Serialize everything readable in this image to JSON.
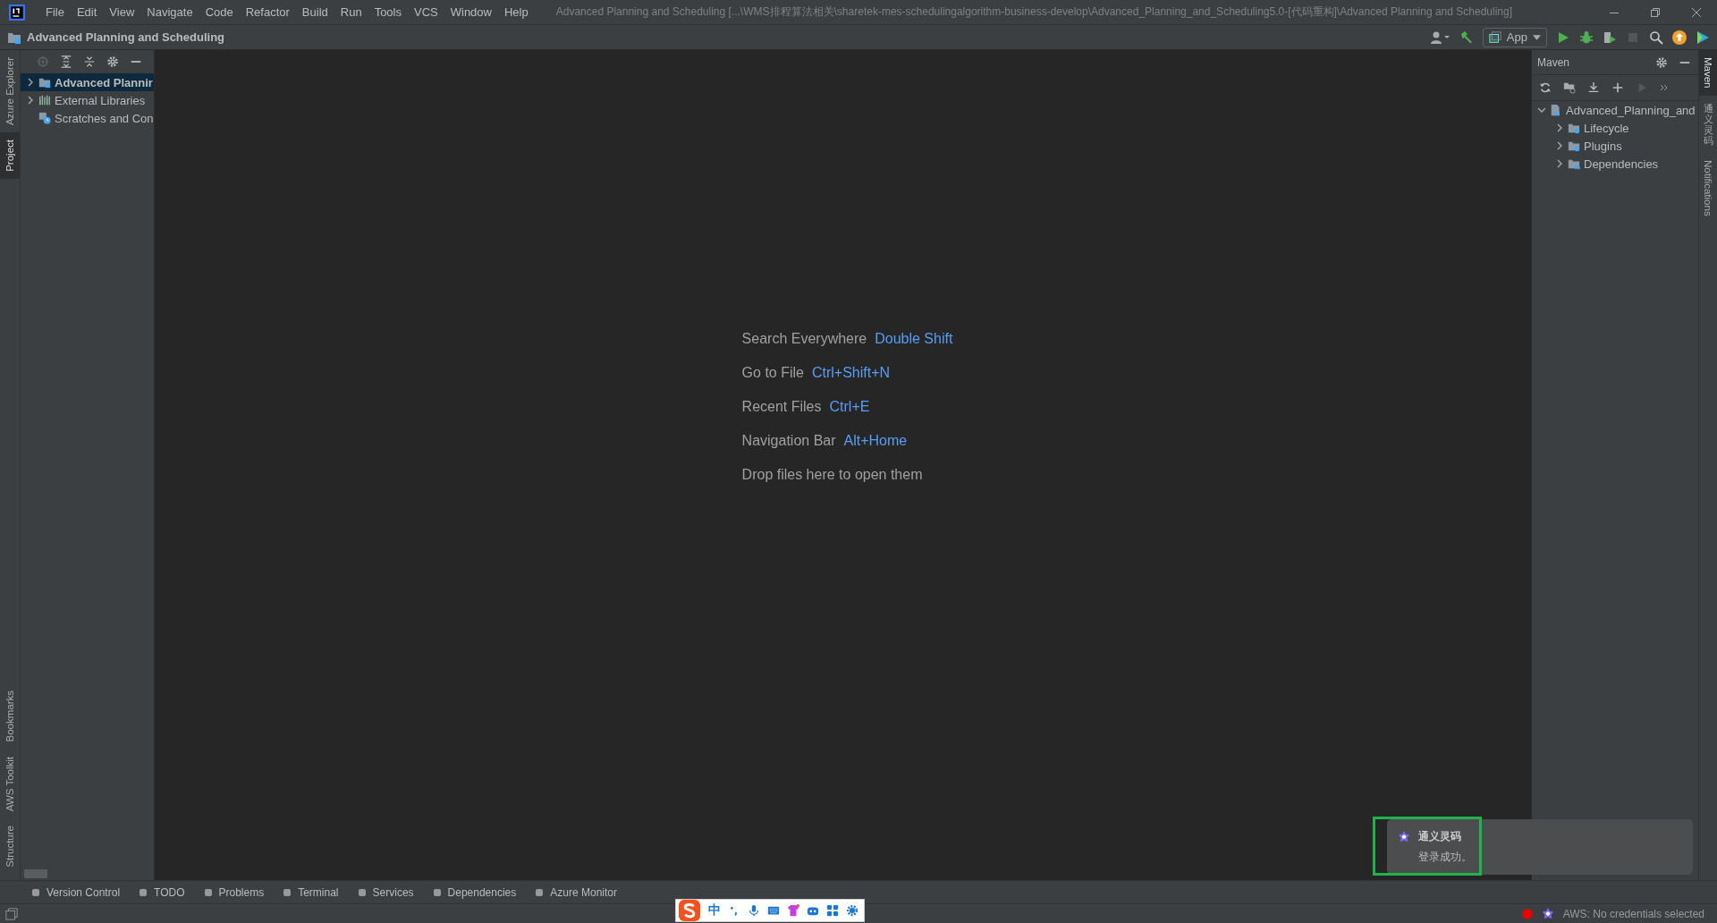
{
  "menu_bar": {
    "items": [
      "File",
      "Edit",
      "View",
      "Navigate",
      "Code",
      "Refactor",
      "Build",
      "Run",
      "Tools",
      "VCS",
      "Window",
      "Help"
    ]
  },
  "window_title": "Advanced Planning and Scheduling [...\\WMS排程算法相关\\sharetek-mes-schedulingalgorithm-business-develop\\Advanced_Planning_and_Scheduling5.0-[代码重构]\\Advanced Planning and Scheduling]",
  "navigation_bar": {
    "project": "Advanced Planning and Scheduling",
    "run_config": "App"
  },
  "left_stripe": {
    "top": [
      {
        "label": "Azure Explorer",
        "selected": false
      },
      {
        "label": "Project",
        "selected": true
      }
    ],
    "bottom": [
      {
        "label": "Bookmarks",
        "selected": false
      },
      {
        "label": "AWS Toolkit",
        "selected": false
      },
      {
        "label": "Structure",
        "selected": false
      }
    ]
  },
  "project_panel": {
    "tree": [
      {
        "label": "Advanced Plannir",
        "kind": "module",
        "expanded": false,
        "selected": true
      },
      {
        "label": "External Libraries",
        "kind": "libraries",
        "expanded": false,
        "selected": false
      },
      {
        "label": "Scratches and Con",
        "kind": "scratches",
        "selected": false
      }
    ]
  },
  "editor": {
    "hints": [
      {
        "action": "Search Everywhere",
        "shortcut": "Double Shift"
      },
      {
        "action": "Go to File",
        "shortcut": "Ctrl+Shift+N"
      },
      {
        "action": "Recent Files",
        "shortcut": "Ctrl+E"
      },
      {
        "action": "Navigation Bar",
        "shortcut": "Alt+Home"
      },
      {
        "action": "Drop files here to open them"
      }
    ]
  },
  "maven_panel": {
    "title": "Maven",
    "tree": [
      {
        "label": "Advanced_Planning_and",
        "kind": "project",
        "expanded": true,
        "children": [
          {
            "label": "Lifecycle",
            "kind": "folder",
            "expanded": false
          },
          {
            "label": "Plugins",
            "kind": "folder",
            "expanded": false
          },
          {
            "label": "Dependencies",
            "kind": "dependencies",
            "expanded": false
          }
        ]
      }
    ]
  },
  "right_stripe": [
    {
      "label": "Maven",
      "selected": true
    },
    {
      "label": "通义灵码",
      "selected": false
    },
    {
      "label": "Notifications",
      "selected": false
    }
  ],
  "notification": {
    "title": "通义灵码",
    "body": "登录成功。"
  },
  "tool_window_bar": [
    "Version Control",
    "TODO",
    "Problems",
    "Terminal",
    "Services",
    "Dependencies",
    "Azure Monitor"
  ],
  "ime_bar": {
    "mode": "中"
  },
  "status_bar": {
    "aws": "AWS: No credentials selected"
  }
}
